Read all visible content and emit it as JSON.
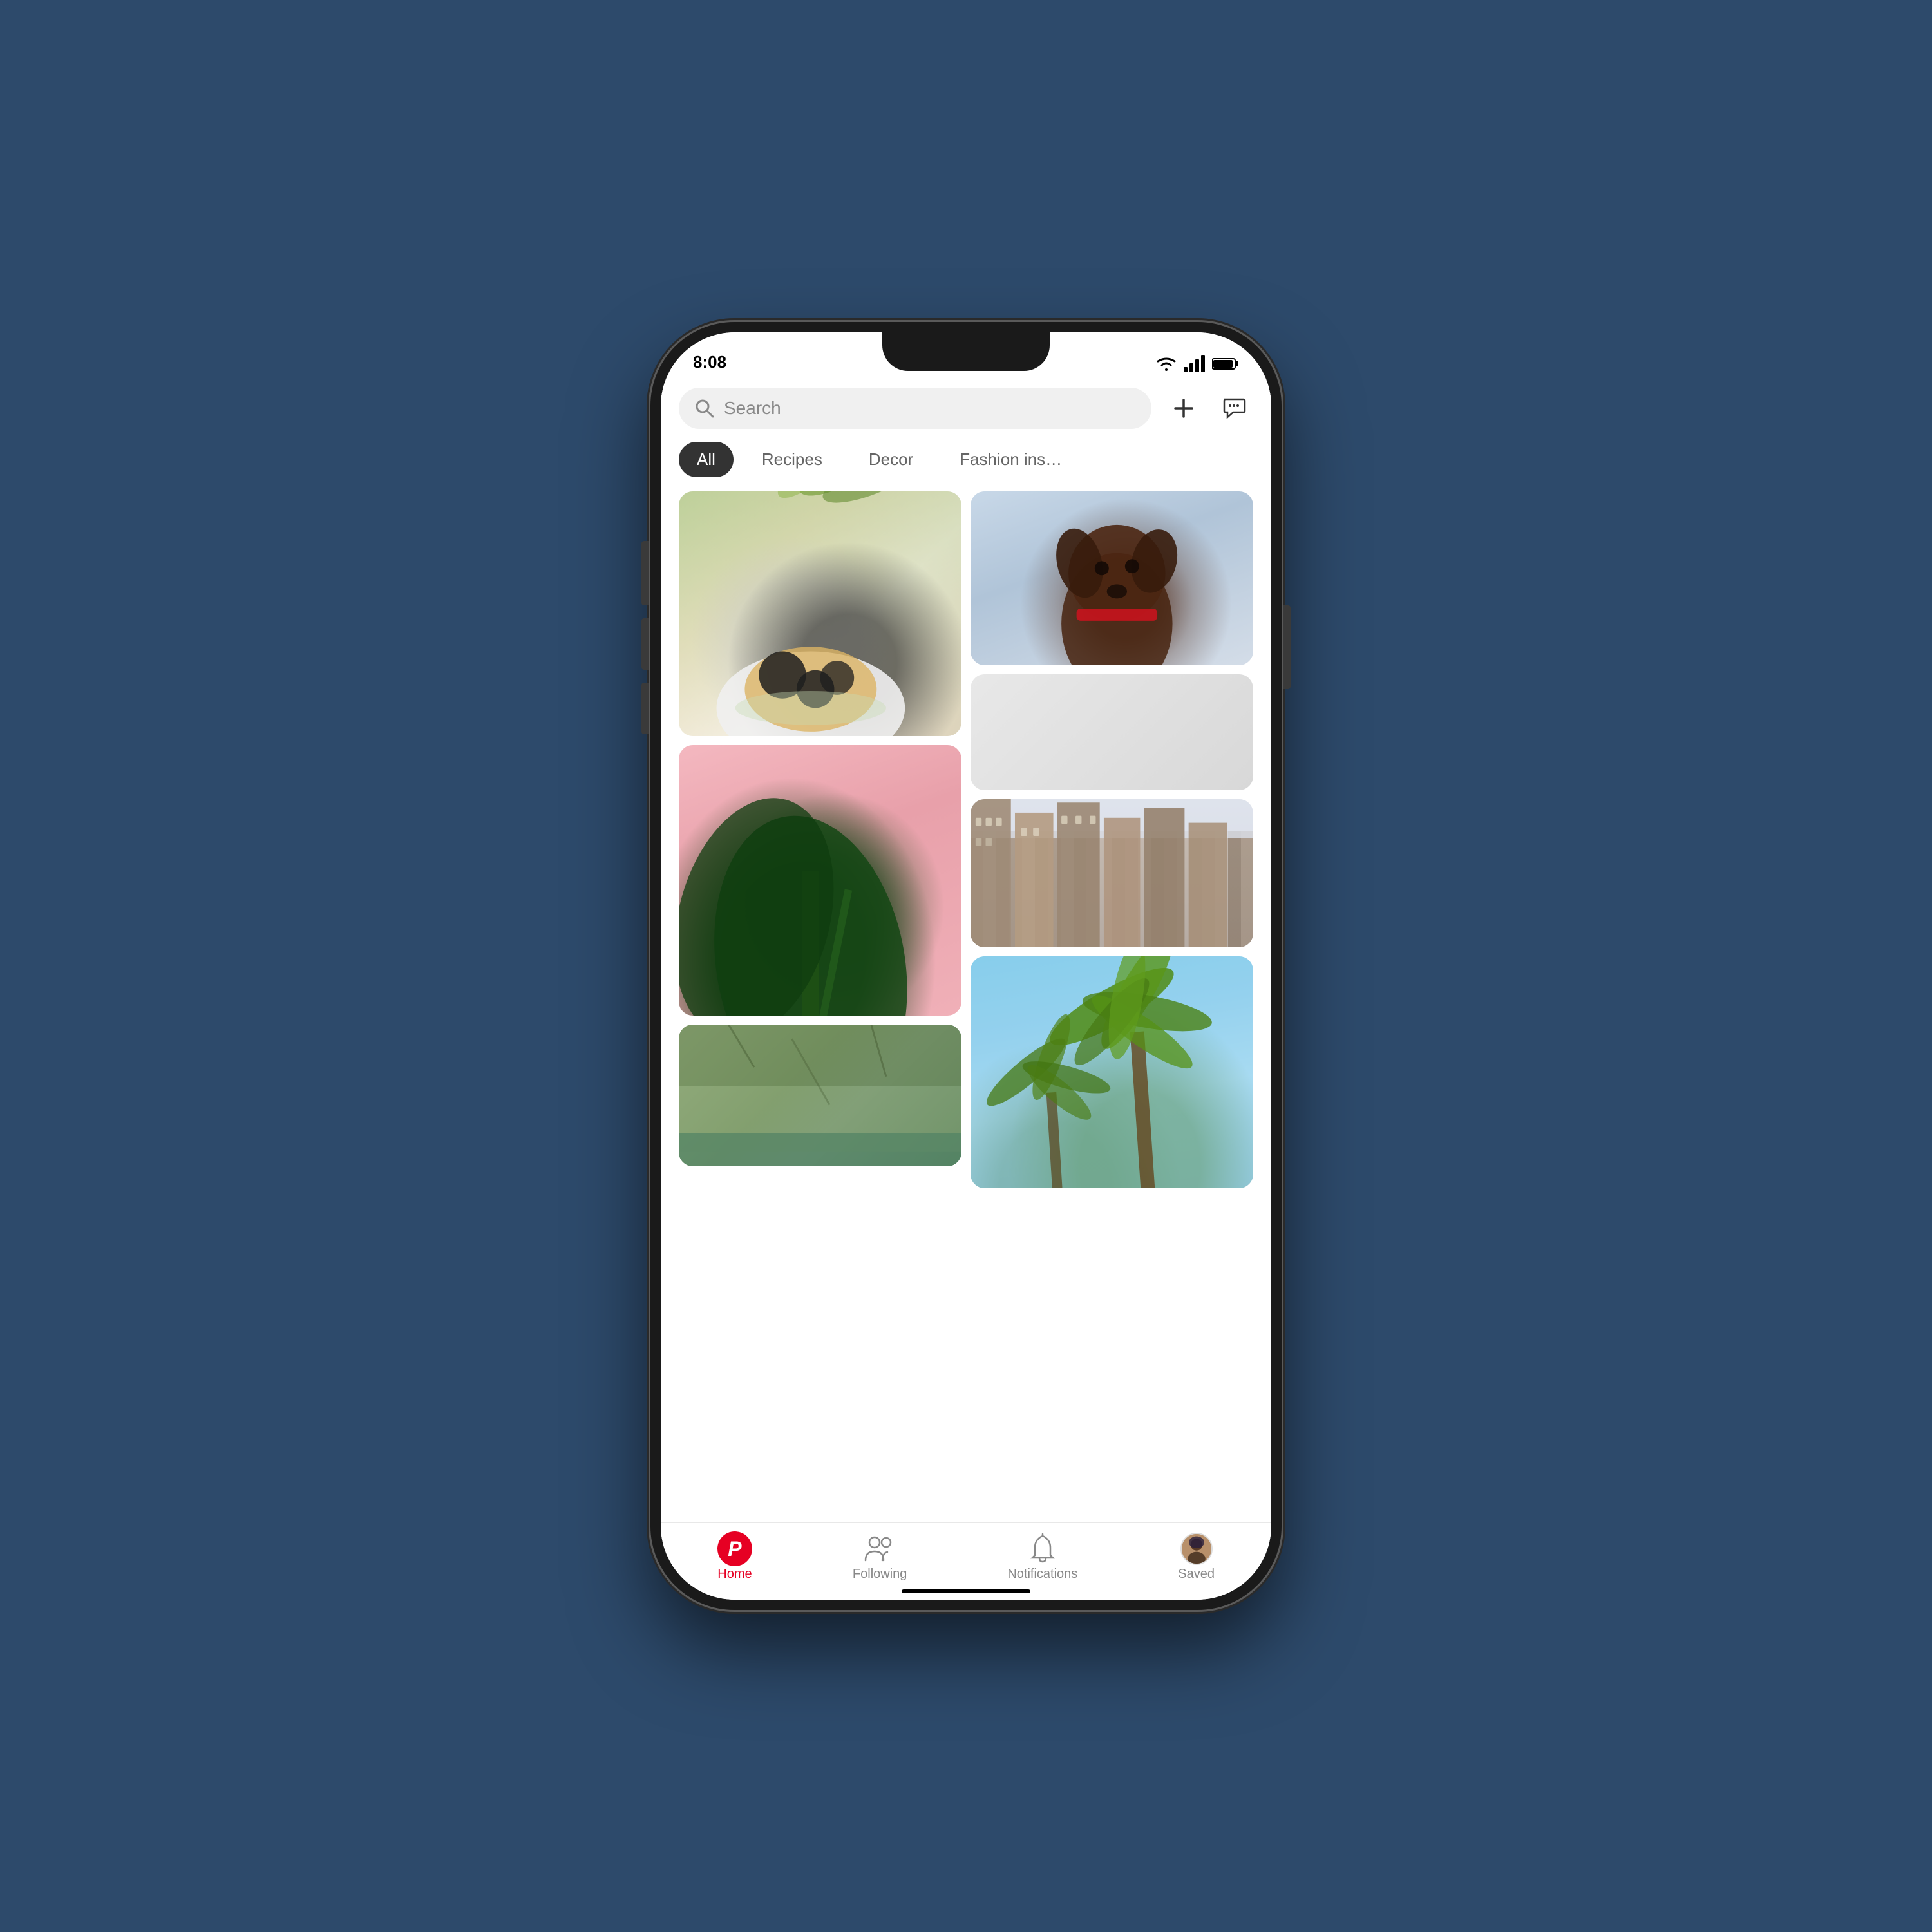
{
  "app": {
    "background_color": "#2d4a6b"
  },
  "status_bar": {
    "time": "8:08"
  },
  "search": {
    "placeholder": "Search"
  },
  "header": {
    "add_label": "+",
    "messages_label": "💬"
  },
  "filter_tabs": [
    {
      "label": "All",
      "active": true
    },
    {
      "label": "Recipes",
      "active": false
    },
    {
      "label": "Decor",
      "active": false
    },
    {
      "label": "Fashion ins…",
      "active": false
    }
  ],
  "bottom_nav": [
    {
      "id": "home",
      "label": "Home",
      "active": true
    },
    {
      "id": "following",
      "label": "Following",
      "active": false
    },
    {
      "id": "notifications",
      "label": "Notifications",
      "active": false
    },
    {
      "id": "saved",
      "label": "Saved",
      "active": false
    }
  ]
}
